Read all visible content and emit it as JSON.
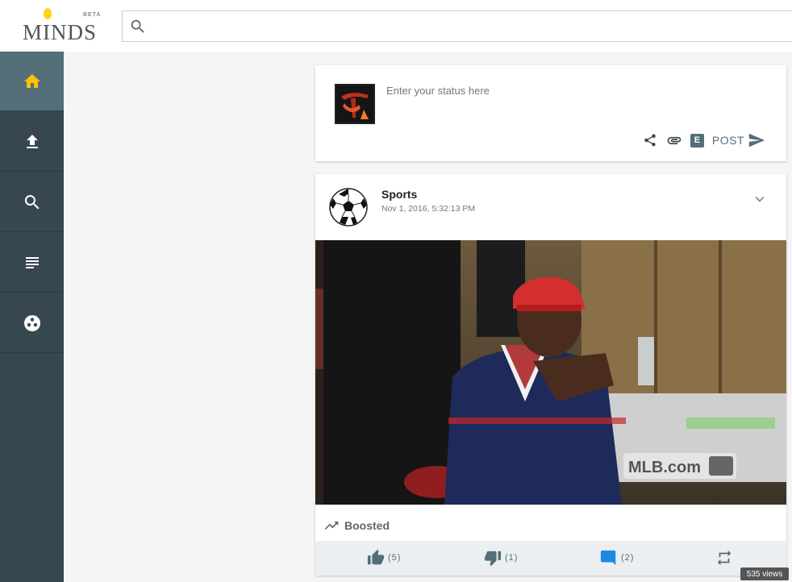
{
  "header": {
    "logo_text": "MINDS",
    "logo_badge": "BETA",
    "search_placeholder": ""
  },
  "sidebar": {
    "items": [
      {
        "name": "home",
        "icon": "home-icon",
        "active": true
      },
      {
        "name": "upload",
        "icon": "upload-icon",
        "active": false
      },
      {
        "name": "search",
        "icon": "search-icon",
        "active": false
      },
      {
        "name": "newsfeed",
        "icon": "list-icon",
        "active": false
      },
      {
        "name": "groups",
        "icon": "groups-icon",
        "active": false
      }
    ]
  },
  "composer": {
    "placeholder": "Enter your status here",
    "post_label": "POST",
    "editor_label": "E"
  },
  "activity": {
    "owner": "Sports",
    "timestamp": "Nov 1, 2016, 5:32:13 PM",
    "media_watermark": "MLB.com",
    "boosted_label": "Boosted",
    "thumbs_up_count": "(5)",
    "thumbs_down_count": "(1)",
    "comments_count": "(2)"
  },
  "views_badge": "535 views",
  "colors": {
    "sidebar_bg": "#37474f",
    "sidebar_active": "#546e7a",
    "home_accent": "#ffc107",
    "comment_blue": "#1e88e5",
    "action_grey": "#546e7a"
  }
}
